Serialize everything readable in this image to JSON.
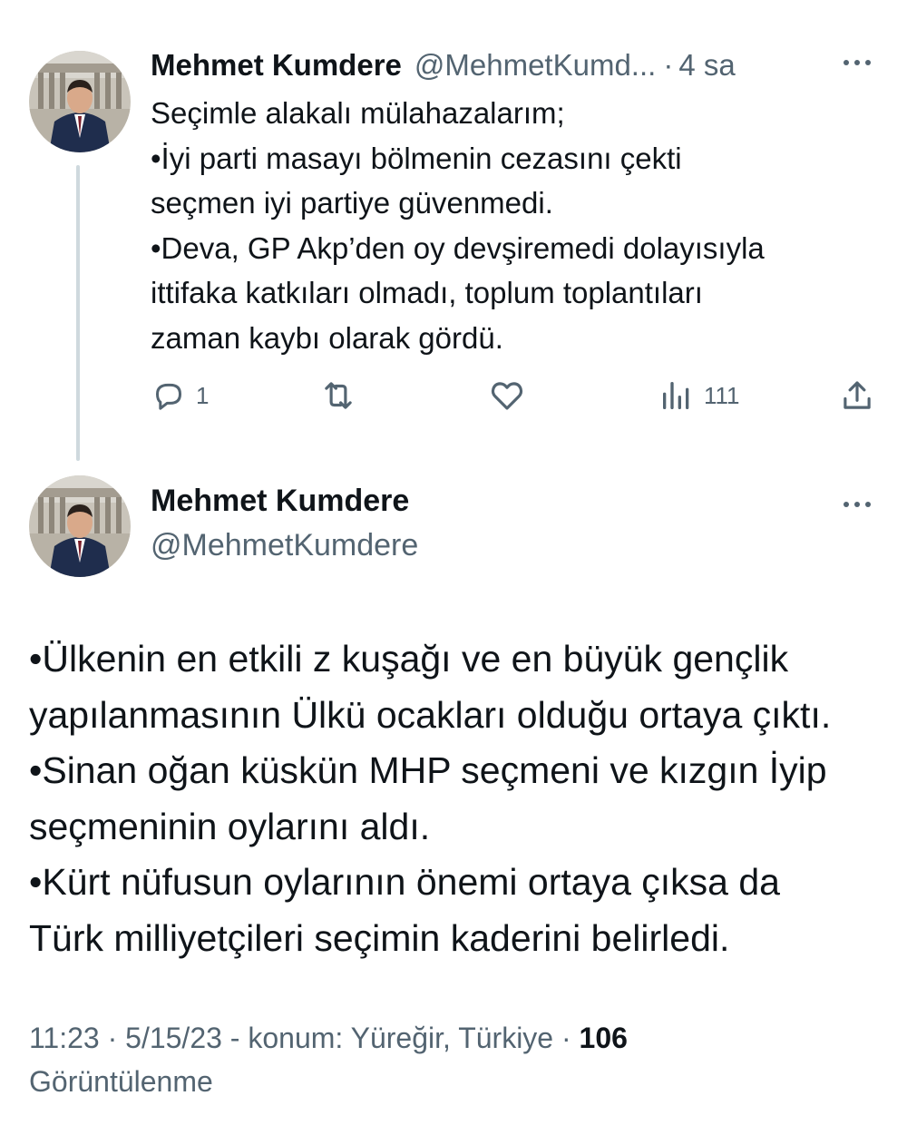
{
  "first_tweet": {
    "author_name": "Mehmet Kumdere",
    "handle": "@MehmetKumd...",
    "separator": "·",
    "time": "4 sa",
    "avatar_icon": "profile-photo",
    "lines": [
      "Seçimle alakalı mülahazalarım;",
      "•İyi parti masayı bölmenin cezasını çekti",
      "seçmen iyi partiye güvenmedi.",
      "•Deva, GP Akp’den oy devşiremedi dolayısıyla",
      "ittifaka katkıları olmadı, toplum toplantıları",
      "zaman kaybı olarak gördü."
    ],
    "actions": {
      "reply_icon": "reply-icon",
      "reply_count": "1",
      "retweet_icon": "retweet-icon",
      "like_icon": "like-icon",
      "views_icon": "views-icon",
      "views_count": "111",
      "share_icon": "share-icon"
    }
  },
  "second_tweet": {
    "author_name": "Mehmet Kumdere",
    "handle": "@MehmetKumdere",
    "avatar_icon": "profile-photo",
    "lines": [
      "•Ülkenin en etkili z kuşağı ve en büyük gençlik",
      "yapılanmasının Ülkü ocakları olduğu ortaya çıktı.",
      "•Sinan oğan küskün MHP seçmeni ve kızgın İyip",
      "seçmeninin oylarını aldı.",
      "•Kürt nüfusun oylarının önemi ortaya çıksa da",
      "Türk milliyetçileri seçimin kaderini belirledi."
    ],
    "meta": {
      "time": "11:23",
      "sep1": " · ",
      "date": "5/15/23",
      "location": " - konum: Yüreğir, Türkiye",
      "sep2": " · ",
      "views_count": "106",
      "views_label": "Görüntülenme"
    }
  },
  "colors": {
    "text": "#0f1419",
    "secondary": "#536471",
    "thread_line": "#cfd9de",
    "background": "#ffffff"
  }
}
